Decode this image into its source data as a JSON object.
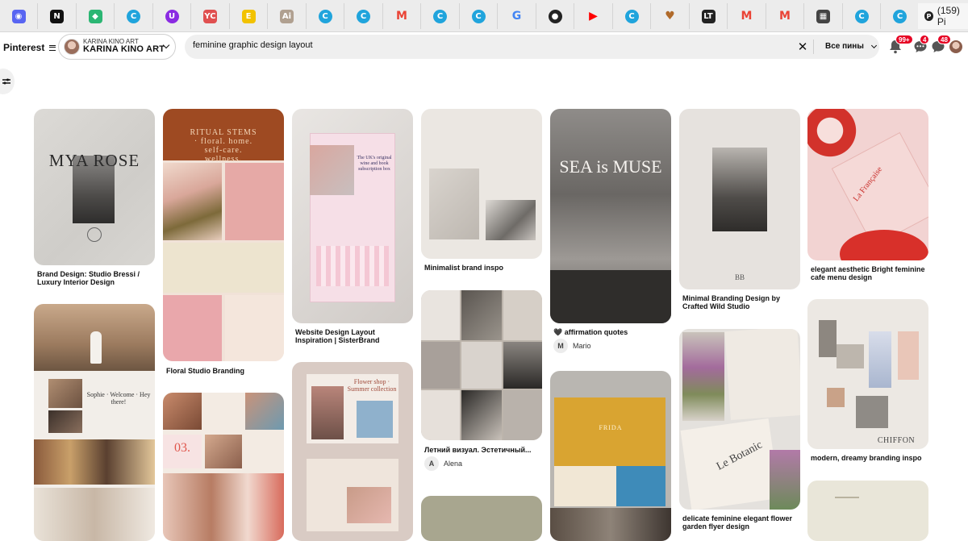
{
  "browser": {
    "active_tab_label": "(159) Pi",
    "tab_icons": [
      {
        "name": "discord-icon",
        "color": "#5865f2",
        "glyph": "◉"
      },
      {
        "name": "notion-icon",
        "color": "#111111",
        "glyph": "N"
      },
      {
        "name": "tag-icon",
        "color": "#2bb673",
        "glyph": "◆"
      },
      {
        "name": "canva-icon",
        "color": "#20a4dc",
        "glyph": "C"
      },
      {
        "name": "u-icon",
        "color": "#8a2be2",
        "glyph": "U"
      },
      {
        "name": "yc-icon",
        "color": "#e05050",
        "glyph": "YC"
      },
      {
        "name": "e-icon",
        "color": "#f2c200",
        "glyph": "E"
      },
      {
        "name": "ai-icon",
        "color": "#b0a090",
        "glyph": "Ai"
      },
      {
        "name": "canva-icon",
        "color": "#20a4dc",
        "glyph": "C"
      },
      {
        "name": "canva-icon",
        "color": "#20a4dc",
        "glyph": "C"
      },
      {
        "name": "gmail-icon",
        "color": "#ea4335",
        "glyph": "M"
      },
      {
        "name": "canva-icon",
        "color": "#20a4dc",
        "glyph": "C"
      },
      {
        "name": "canva-icon",
        "color": "#20a4dc",
        "glyph": "C"
      },
      {
        "name": "google-icon",
        "color": "#4285f4",
        "glyph": "G"
      },
      {
        "name": "circle-icon",
        "color": "#222222",
        "glyph": "●"
      },
      {
        "name": "youtube-icon",
        "color": "#ff0000",
        "glyph": "▶"
      },
      {
        "name": "canva-icon",
        "color": "#20a4dc",
        "glyph": "C"
      },
      {
        "name": "heart-icon",
        "color": "#b06a2a",
        "glyph": "♥"
      },
      {
        "name": "lt-icon",
        "color": "#222222",
        "glyph": "LT"
      },
      {
        "name": "gmail-icon",
        "color": "#ea4335",
        "glyph": "M"
      },
      {
        "name": "gmail-icon",
        "color": "#ea4335",
        "glyph": "M"
      },
      {
        "name": "calendar-icon",
        "color": "#444444",
        "glyph": "▦"
      },
      {
        "name": "canva-icon",
        "color": "#20a4dc",
        "glyph": "C"
      },
      {
        "name": "canva-icon",
        "color": "#20a4dc",
        "glyph": "C"
      }
    ]
  },
  "header": {
    "brand": "Pinterest",
    "account_small": "KARINA KINO ART",
    "account_big": "KARINA KINO ART",
    "search_value": "feminine graphic design layout",
    "search_scope": "Все пины",
    "notifications_badge": "99+",
    "messages_badge": "4",
    "updates_badge": "48"
  },
  "pins": [
    {
      "title": "Brand Design: Studio Bressi / Luxury Interior Design",
      "overlay": "MYA ROSE"
    },
    {
      "title": "",
      "overlay": "Sophie · Welcome · Hey there!"
    },
    {
      "title": "Floral Studio Branding",
      "overlay": "RITUAL STEMS · floral. home. self-care. wellness."
    },
    {
      "title": "",
      "overlay": "03."
    },
    {
      "title": "Website Design Layout Inspiration | SisterBrand",
      "overlay": "The UK's original wine and book subscription box"
    },
    {
      "title": "",
      "overlay": "Flower shop · Summer collection"
    },
    {
      "title": "Minimalist brand inspo",
      "overlay": ""
    },
    {
      "title": "Летний визуал. Эстетичный...",
      "user": "Alena",
      "user_initial": "A"
    },
    {
      "title": "",
      "overlay": ""
    },
    {
      "title": "🖤 affirmation quotes",
      "user": "Mario",
      "user_initial": "M",
      "overlay": "SEA is MUSE"
    },
    {
      "title": "",
      "overlay": "FRIDA"
    },
    {
      "title": "Minimal Branding Design by Crafted Wild Studio",
      "overlay": "BB"
    },
    {
      "title": "delicate feminine elegant flower garden flyer design",
      "overlay": "Le Botanic"
    },
    {
      "title": "elegant aesthetic Bright feminine cafe menu design",
      "overlay": "La Française"
    },
    {
      "title": "modern, dreamy branding inspo",
      "overlay": "CHIFFON"
    },
    {
      "title": "",
      "overlay": ""
    }
  ]
}
